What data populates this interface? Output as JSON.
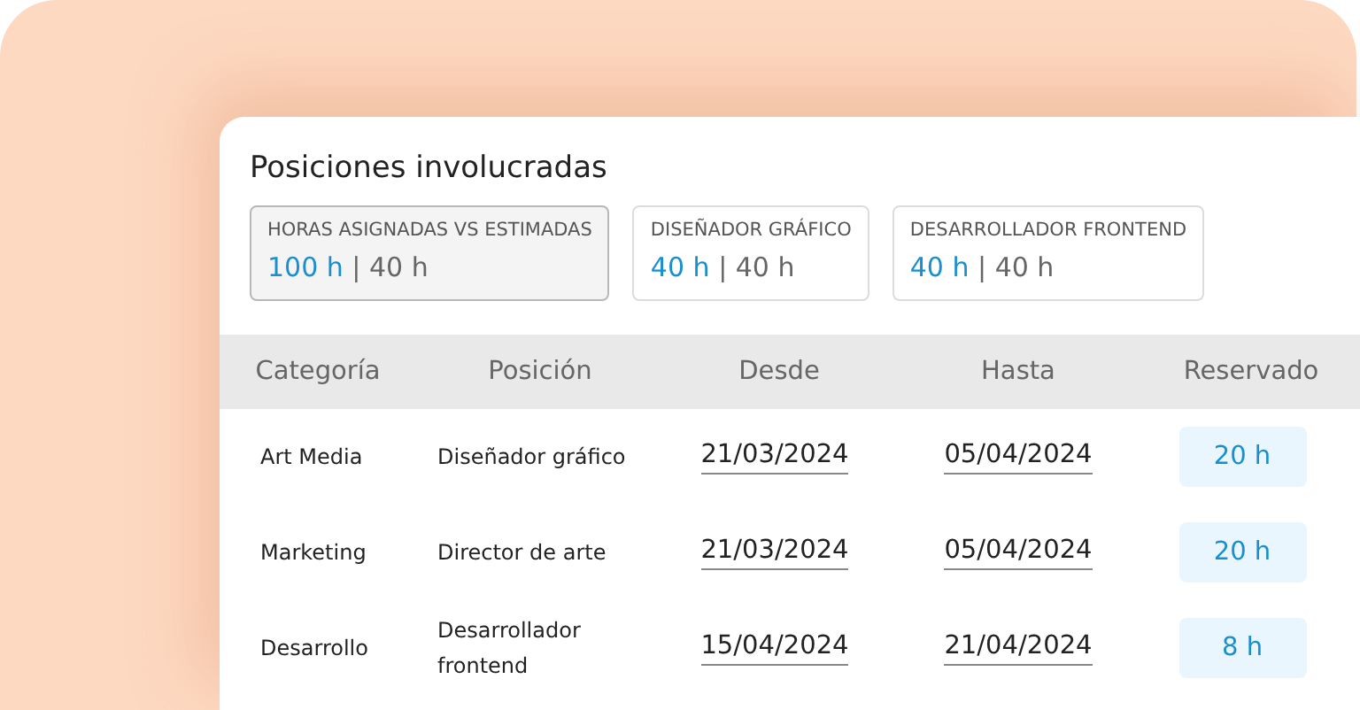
{
  "title": "Posiciones involucradas",
  "summary_cards": [
    {
      "label": "HORAS ASIGNADAS VS ESTIMADAS",
      "value": "**100 h** | 40 h",
      "selected": true
    },
    {
      "label": "DISEÑADOR GRÁFICO",
      "value": "**40 h** | 40 h",
      "selected": false
    },
    {
      "label": "DESARROLLADOR FRONTEND",
      "value": "**40 h** | 40 h",
      "selected": false
    }
  ],
  "table": {
    "columns": [
      "Categoría",
      "Posición",
      "Desde",
      "Hasta",
      "Reservado"
    ],
    "rows": [
      {
        "category": "Art Media",
        "position": "Diseñador gráfico",
        "from": "21/03/2024",
        "to": "05/04/2024",
        "reserved": "20 h"
      },
      {
        "category": "Marketing",
        "position": "Director de arte",
        "from": "21/03/2024",
        "to": "05/04/2024",
        "reserved": "20 h"
      },
      {
        "category": "Desarrollo",
        "position": "Desarrollador frontend",
        "from": "15/04/2024",
        "to": "21/04/2024",
        "reserved": "8 h"
      }
    ]
  }
}
